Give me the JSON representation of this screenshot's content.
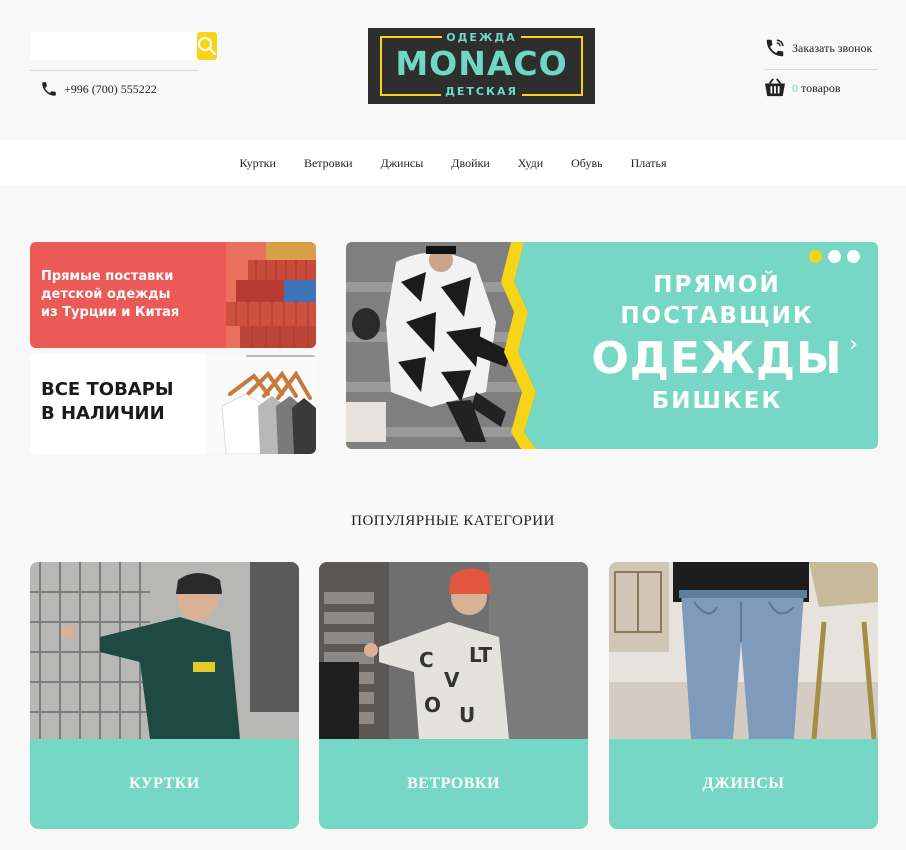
{
  "header": {
    "search": {
      "placeholder": "",
      "value": ""
    },
    "phone": "+996 (700) 555222",
    "callback_label": "Заказать звонок",
    "cart": {
      "count": "0",
      "label": "товаров"
    }
  },
  "logo": {
    "top": "ОДЕЖДА",
    "main": "MONACO",
    "bottom": "ДЕТСКАЯ"
  },
  "nav": {
    "items": [
      "Куртки",
      "Ветровки",
      "Джинсы",
      "Двойки",
      "Худи",
      "Обувь",
      "Платья"
    ]
  },
  "banners": {
    "side_top": {
      "lines": [
        "Прямые поставки",
        "детской одежды",
        "из Турции и Китая"
      ]
    },
    "side_bottom": {
      "lines": [
        "ВСЕ ТОВАРЫ",
        "В НАЛИЧИИ"
      ]
    },
    "main": {
      "lines": [
        "ПРЯМОЙ",
        "ПОСТАВЩИК",
        "ОДЕЖДЫ",
        "БИШКЕК"
      ],
      "slides": 3,
      "active_slide": 1,
      "next_arrow": "›"
    }
  },
  "categories": {
    "title": "ПОПУЛЯРНЫЕ КАТЕГОРИИ",
    "items": [
      {
        "label": "КУРТКИ"
      },
      {
        "label": "ВЕТРОВКИ"
      },
      {
        "label": "ДЖИНСЫ"
      }
    ]
  },
  "colors": {
    "accent_teal": "#76d7c4",
    "accent_yellow": "#f7d417",
    "banner_red": "#ec5a57",
    "logo_bg": "#2e2e2e"
  }
}
